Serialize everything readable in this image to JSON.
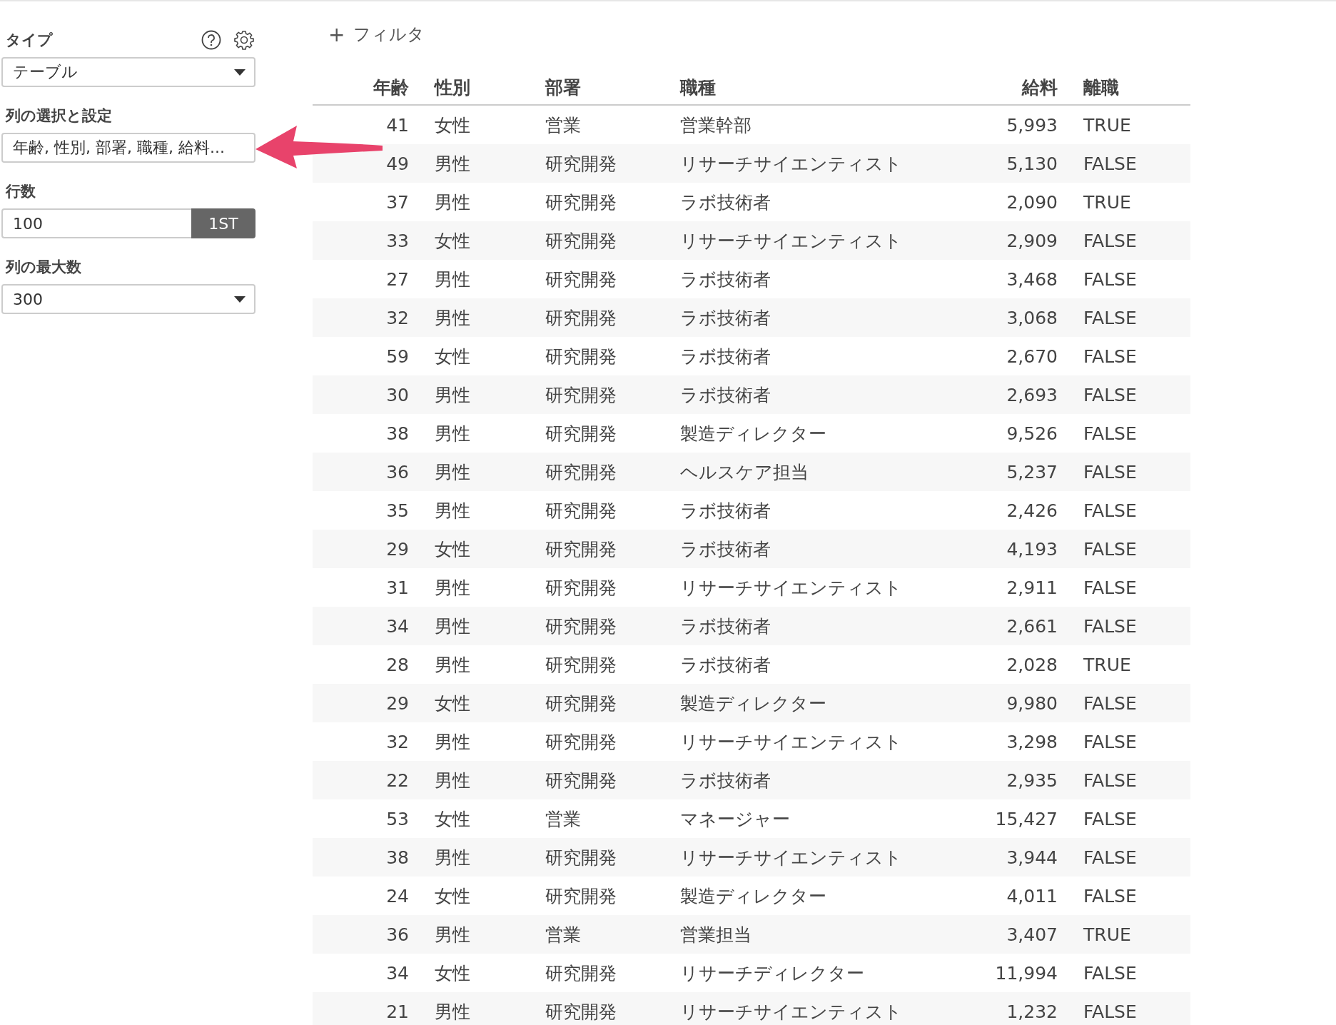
{
  "sidebar": {
    "type_label": "タイプ",
    "type_value": "テーブル",
    "columns_label": "列の選択と設定",
    "columns_value": "年齢, 性別, 部署, 職種, 給料...",
    "rows_label": "行数",
    "rows_value": "100",
    "rows_button": "1ST",
    "max_columns_label": "列の最大数",
    "max_columns_value": "300"
  },
  "filter": {
    "icon": "+",
    "label": "フィルタ"
  },
  "table": {
    "columns": [
      {
        "label": "年齢",
        "kind": "number"
      },
      {
        "label": "性別",
        "kind": "text"
      },
      {
        "label": "部署",
        "kind": "text"
      },
      {
        "label": "職種",
        "kind": "text"
      },
      {
        "label": "給料",
        "kind": "number"
      },
      {
        "label": "離職",
        "kind": "text"
      }
    ],
    "rows": [
      [
        "41",
        "女性",
        "営業",
        "営業幹部",
        "5,993",
        "TRUE"
      ],
      [
        "49",
        "男性",
        "研究開発",
        "リサーチサイエンティスト",
        "5,130",
        "FALSE"
      ],
      [
        "37",
        "男性",
        "研究開発",
        "ラボ技術者",
        "2,090",
        "TRUE"
      ],
      [
        "33",
        "女性",
        "研究開発",
        "リサーチサイエンティスト",
        "2,909",
        "FALSE"
      ],
      [
        "27",
        "男性",
        "研究開発",
        "ラボ技術者",
        "3,468",
        "FALSE"
      ],
      [
        "32",
        "男性",
        "研究開発",
        "ラボ技術者",
        "3,068",
        "FALSE"
      ],
      [
        "59",
        "女性",
        "研究開発",
        "ラボ技術者",
        "2,670",
        "FALSE"
      ],
      [
        "30",
        "男性",
        "研究開発",
        "ラボ技術者",
        "2,693",
        "FALSE"
      ],
      [
        "38",
        "男性",
        "研究開発",
        "製造ディレクター",
        "9,526",
        "FALSE"
      ],
      [
        "36",
        "男性",
        "研究開発",
        "ヘルスケア担当",
        "5,237",
        "FALSE"
      ],
      [
        "35",
        "男性",
        "研究開発",
        "ラボ技術者",
        "2,426",
        "FALSE"
      ],
      [
        "29",
        "女性",
        "研究開発",
        "ラボ技術者",
        "4,193",
        "FALSE"
      ],
      [
        "31",
        "男性",
        "研究開発",
        "リサーチサイエンティスト",
        "2,911",
        "FALSE"
      ],
      [
        "34",
        "男性",
        "研究開発",
        "ラボ技術者",
        "2,661",
        "FALSE"
      ],
      [
        "28",
        "男性",
        "研究開発",
        "ラボ技術者",
        "2,028",
        "TRUE"
      ],
      [
        "29",
        "女性",
        "研究開発",
        "製造ディレクター",
        "9,980",
        "FALSE"
      ],
      [
        "32",
        "男性",
        "研究開発",
        "リサーチサイエンティスト",
        "3,298",
        "FALSE"
      ],
      [
        "22",
        "男性",
        "研究開発",
        "ラボ技術者",
        "2,935",
        "FALSE"
      ],
      [
        "53",
        "女性",
        "営業",
        "マネージャー",
        "15,427",
        "FALSE"
      ],
      [
        "38",
        "男性",
        "研究開発",
        "リサーチサイエンティスト",
        "3,944",
        "FALSE"
      ],
      [
        "24",
        "女性",
        "研究開発",
        "製造ディレクター",
        "4,011",
        "FALSE"
      ],
      [
        "36",
        "男性",
        "営業",
        "営業担当",
        "3,407",
        "TRUE"
      ],
      [
        "34",
        "女性",
        "研究開発",
        "リサーチディレクター",
        "11,994",
        "FALSE"
      ],
      [
        "21",
        "男性",
        "研究開発",
        "リサーチサイエンティスト",
        "1,232",
        "FALSE"
      ]
    ]
  }
}
